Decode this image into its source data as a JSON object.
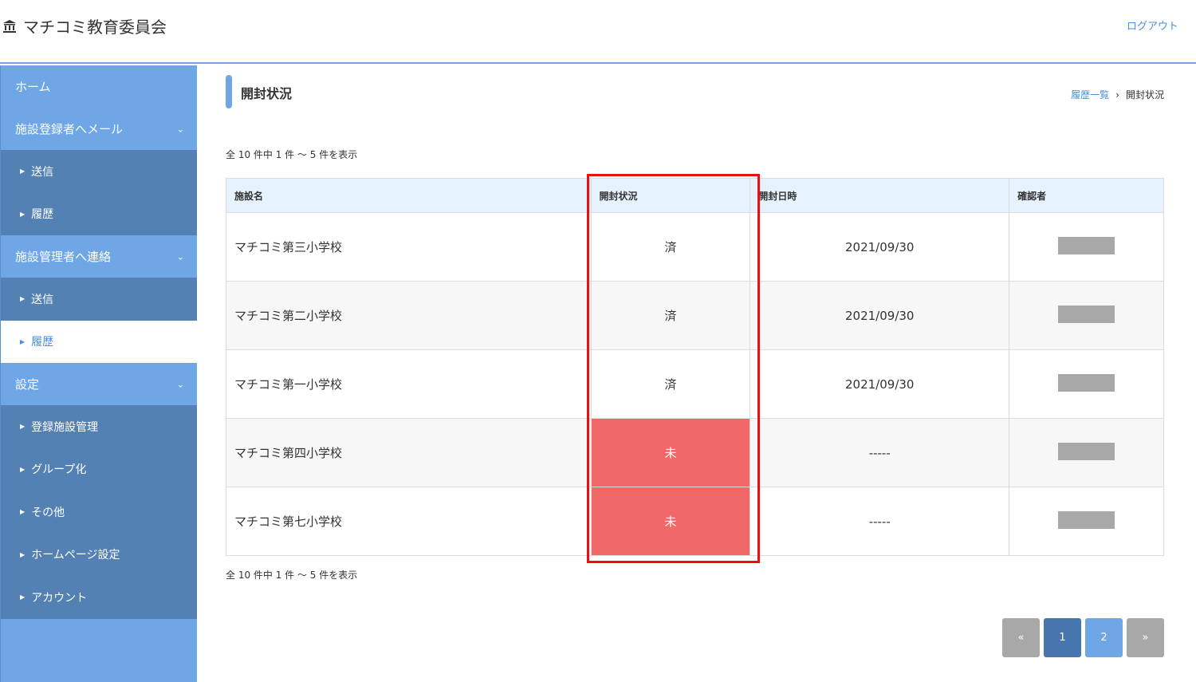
{
  "header": {
    "brand_icon": "museum-icon",
    "brand_text": "マチコミ教育委員会",
    "logout": "ログアウト"
  },
  "sidebar": {
    "home": "ホーム",
    "mail_group": "施設登録者へメール",
    "mail_send": "送信",
    "mail_history": "履歴",
    "contact_group": "施設管理者へ連絡",
    "contact_send": "送信",
    "contact_history": "履歴",
    "settings_group": "設定",
    "settings_facility": "登録施設管理",
    "settings_group_item": "グループ化",
    "settings_other": "その他",
    "settings_homepage": "ホームページ設定",
    "settings_account": "アカウント"
  },
  "main": {
    "title": "開封状況",
    "breadcrumb_link": "履歴一覧",
    "breadcrumb_sep": "›",
    "breadcrumb_current": "開封状況",
    "count_text": "全 10 件中 1 件 ～ 5 件を表示"
  },
  "table": {
    "headers": [
      "施設名",
      "開封状況",
      "開封日時",
      "確認者"
    ],
    "rows": [
      {
        "name": "マチコミ第三小学校",
        "status": "済",
        "date": "2021/09/30"
      },
      {
        "name": "マチコミ第二小学校",
        "status": "済",
        "date": "2021/09/30"
      },
      {
        "name": "マチコミ第一小学校",
        "status": "済",
        "date": "2021/09/30"
      },
      {
        "name": "マチコミ第四小学校",
        "status": "未",
        "date": "-----"
      },
      {
        "name": "マチコミ第七小学校",
        "status": "未",
        "date": "-----"
      }
    ]
  },
  "pagination": {
    "first": "«",
    "page1": "1",
    "page2": "2",
    "last": "»"
  },
  "colors": {
    "accent": "#6ea6e6",
    "sidebar_sub": "#5381b3",
    "unopened": "#f06868",
    "highlight": "#e81010"
  }
}
